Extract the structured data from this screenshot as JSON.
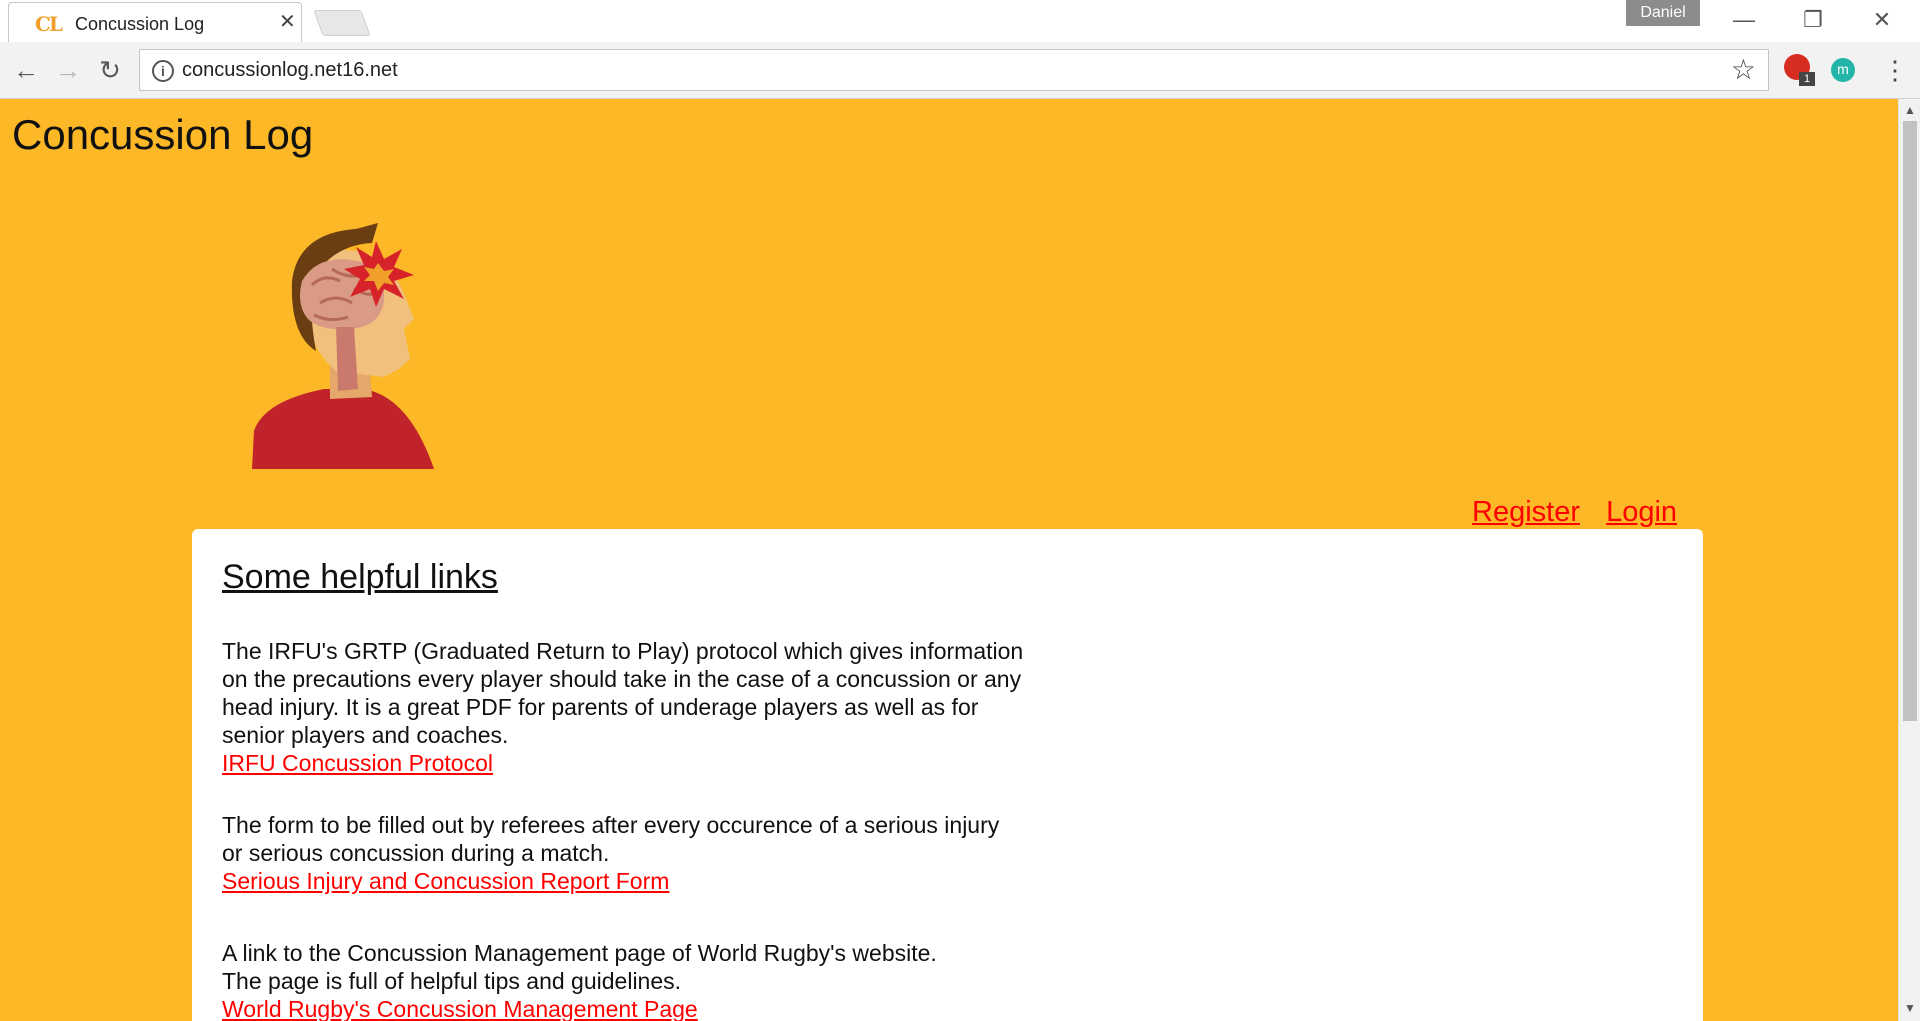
{
  "browser": {
    "tab_title": "Concussion Log",
    "tab_favicon_text": "CL",
    "tab_close_glyph": "✕",
    "profile_name": "Daniel",
    "url": "concussionlog.net16.net",
    "extension_badge": "1",
    "extension2_letter": "m",
    "window_minimize": "—",
    "window_restore": "❐",
    "window_close": "✕"
  },
  "page": {
    "title": "Concussion Log",
    "nav": {
      "register": "Register",
      "login": "Login"
    },
    "panel": {
      "heading": "Some helpful links",
      "items": [
        {
          "text_lines": [
            "The IRFU's GRTP (Graduated Return to Play) protocol which gives information",
            "on the precautions every player should take in the case of a concussion or any",
            "head injury. It is a great PDF for parents of underage players as well as for",
            "senior players and coaches."
          ],
          "link": "IRFU Concussion Protocol"
        },
        {
          "text_lines": [
            "The form to be filled out by referees after every occurence of a serious injury",
            "or serious concussion during a match."
          ],
          "link": "Serious Injury and Concussion Report Form"
        },
        {
          "text_lines": [
            "A link to the Concussion Management page of World Rugby's website.",
            "The page is full of helpful tips and guidelines."
          ],
          "link": "World Rugby's Concussion Management Page"
        }
      ]
    }
  },
  "colors": {
    "page_background": "#fdb827",
    "link": "#ff0000",
    "panel": "#ffffff"
  },
  "icons": [
    "back-icon",
    "forward-icon",
    "reload-icon",
    "info-icon",
    "star-icon",
    "menu-icon",
    "concussion-logo"
  ]
}
